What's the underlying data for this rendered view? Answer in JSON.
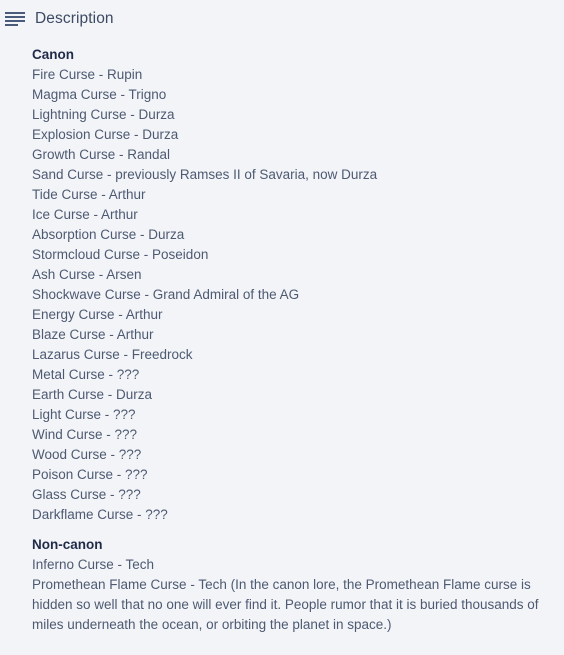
{
  "header": {
    "title": "Description",
    "icon": "description-lines-icon"
  },
  "colors": {
    "background": "#f2f4f7",
    "heading_text": "#1f2b48",
    "body_text": "#4e5a72",
    "title_text": "#3d4a63",
    "icon": "#4a5a7a"
  },
  "sections": [
    {
      "heading": "Canon",
      "items": [
        "Fire Curse - Rupin",
        "Magma Curse - Trigno",
        "Lightning Curse - Durza",
        "Explosion Curse - Durza",
        "Growth Curse - Randal",
        "Sand Curse - previously Ramses II of Savaria, now Durza",
        "Tide Curse - Arthur",
        "Ice Curse - Arthur",
        "Absorption Curse - Durza",
        "Stormcloud Curse - Poseidon",
        "Ash Curse - Arsen",
        "Shockwave Curse - Grand Admiral of the AG",
        "Energy Curse - Arthur",
        "Blaze Curse - Arthur",
        "Lazarus Curse - Freedrock",
        "Metal Curse - ???",
        "Earth Curse - Durza",
        "Light Curse - ???",
        "Wind Curse - ???",
        "Wood Curse - ???",
        "Poison Curse - ???",
        "Glass Curse - ???",
        "Darkflame Curse - ???"
      ]
    },
    {
      "heading": "Non-canon",
      "items": [
        "Inferno Curse - Tech"
      ],
      "paragraph": "Promethean Flame Curse - Tech (In the canon lore, the Promethean Flame curse is hidden so well that no one will ever find it. People rumor that it is buried thousands of miles underneath the ocean, or orbiting the planet in space.)"
    }
  ]
}
